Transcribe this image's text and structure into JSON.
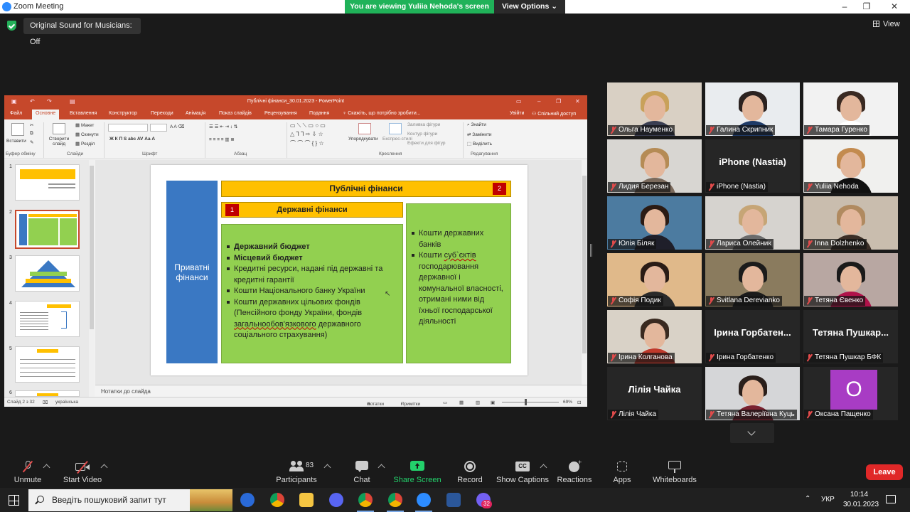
{
  "window": {
    "title": "Zoom Meeting",
    "viewing_banner": "You are viewing Yuliia Nehoda's screen",
    "view_options": "View Options",
    "minimize": "–",
    "maximize": "❐",
    "close": "✕"
  },
  "top": {
    "sound_badge": "Original Sound for Musicians: Off",
    "view_label": "View"
  },
  "ppt": {
    "doc_title": "Публічні фінанси_30.01.2023 - PowerPoint",
    "tabs": [
      "Файл",
      "Основне",
      "Вставлення",
      "Конструктор",
      "Переходи",
      "Анімація",
      "Показ слайдів",
      "Рецензування",
      "Подання"
    ],
    "tell_me": "Скажіть, що потрібно зробити...",
    "sign_in": "Увійти",
    "share": "Спільний доступ",
    "ribbon": {
      "paste": "Вставити",
      "clipboard_group": "Буфер обміну",
      "layout": "Макет",
      "reset": "Скинути",
      "section": "Розділ",
      "new_slide": "Створити слайд",
      "slides_group": "Слайди",
      "font_group": "Шрифт",
      "paragraph_group": "Абзац",
      "arrange": "Упорядкувати",
      "quick_styles": "Експрес-стилі",
      "shape_fill": "Заливка фігури",
      "shape_outline": "Контур фігури",
      "shape_effects": "Ефекти для фігур",
      "drawing_group": "Креслення",
      "find": "Знайти",
      "replace": "Замінити",
      "select": "Виділить",
      "editing_group": "Редагування"
    },
    "thumb_numbers": [
      "1",
      "2",
      "3",
      "4",
      "5",
      "6"
    ],
    "slide": {
      "private": "Приватні фінанси",
      "public": "Публічні фінанси",
      "state": "Державні фінанси",
      "badge_public": "2",
      "badge_state": "1",
      "state_items_bold": [
        "Державний бюджет",
        "Місцевий бюджет"
      ],
      "state_item_3": "Кредитні ресурси, надані під державні та кредитні гарантії",
      "state_item_4": "Кошти Національного банку України",
      "state_item_5_a": "Кошти державних цільових фондів (Пенсійного фонду України, фондів ",
      "state_item_5_u": "загальнообов'язкового",
      "state_item_5_b": " державного соціального страхування)",
      "other_item_1": "Кошти державних банків",
      "other_item_2_a": "Кошти ",
      "other_item_2_u": "суб`єктів",
      "other_item_2_b": " господарювання державної і комунальної власності, отримані ними від їхньої господарської діяльності"
    },
    "notes": "Нотатки до слайда",
    "status": {
      "slide_of": "Слайд 2 з 32",
      "language": "українська",
      "notes_btn": "Нотатки",
      "comments_btn": "Примітки",
      "zoom": "69%"
    }
  },
  "participants": [
    {
      "name": "Ольга Науменко",
      "video": true,
      "bg": "#d9d0c4",
      "hair": "#c9a15a",
      "body": "#3a3e52"
    },
    {
      "name": "Галина Скрипник",
      "video": true,
      "bg": "#e9ecef",
      "hair": "#2b2220",
      "body": "#1f3b68"
    },
    {
      "name": "Тамара Гуренко",
      "video": true,
      "bg": "#f2f2f2",
      "hair": "#3a2a22",
      "body": "#ffffff"
    },
    {
      "name": "Лидия Березан",
      "video": true,
      "bg": "#d8d6d2",
      "hair": "#b58b55",
      "body": "#7b6a5c"
    },
    {
      "name": "iPhone (Nastia)",
      "video": false,
      "display": "iPhone (Nastia)"
    },
    {
      "name": "Yuliia Nehoda",
      "video": true,
      "bg": "#f0f0ee",
      "hair": "#c38b4f",
      "body": "#111111",
      "active": true
    },
    {
      "name": "Юлія Біляк",
      "video": true,
      "bg": "#4c7ba0",
      "hair": "#2b1b14",
      "body": "#1f1f2a"
    },
    {
      "name": "Лариса Олейник",
      "video": true,
      "bg": "#d6d3cf",
      "hair": "#c6a576",
      "body": "#6b6b6b"
    },
    {
      "name": "Inna Dolzhenko",
      "video": true,
      "bg": "#c9bdae",
      "hair": "#b08a60",
      "body": "#3c2f27"
    },
    {
      "name": "Софія Подик",
      "video": true,
      "bg": "#e0b98a",
      "hair": "#2a1c16",
      "body": "#2a2a2a"
    },
    {
      "name": "Svitlana Derevianko",
      "video": true,
      "bg": "#8a7b5e",
      "hair": "#1b1b1b",
      "body": "#1b1b1b"
    },
    {
      "name": "Тетяна Євенко",
      "video": true,
      "bg": "#b8a7a2",
      "hair": "#1a1a1a",
      "body": "#b0124a"
    },
    {
      "name": "Ірина Колганова",
      "video": true,
      "bg": "#d9d2c7",
      "hair": "#3a2a20",
      "body": "#c0392b"
    },
    {
      "name": "Ірина Горбатенко",
      "video": false,
      "display": "Ірина Горбатен..."
    },
    {
      "name": "Тетяна Пушкар БФК",
      "video": false,
      "display": "Тетяна Пушкар..."
    },
    {
      "name": "Лілія Чайка",
      "video": false,
      "display": "Лілія Чайка"
    },
    {
      "name": "Тетяна Валеріївна Куць",
      "video": true,
      "bg": "#d5d6d8",
      "hair": "#2a1f1b",
      "body": "#7a2230"
    },
    {
      "name": "Оксана Пащенко",
      "video": false,
      "avatar": "O"
    }
  ],
  "toolbar": {
    "unmute": "Unmute",
    "start_video": "Start Video",
    "participants": "Participants",
    "participants_count": "83",
    "chat": "Chat",
    "share_screen": "Share Screen",
    "record": "Record",
    "show_captions": "Show Captions",
    "reactions": "Reactions",
    "apps": "Apps",
    "whiteboards": "Whiteboards",
    "leave": "Leave"
  },
  "taskbar": {
    "search_placeholder": "Введіть пошуковий запит тут",
    "lang": "УКР",
    "time": "10:14",
    "date": "30.01.2023",
    "badge_count": "32"
  },
  "colors": {
    "zoom_blue": "#2d8cff",
    "banner_green": "#20b259",
    "ppt_red": "#c6482b",
    "slide_blue": "#3a78c3",
    "slide_yellow": "#ffc000",
    "slide_green": "#92d050",
    "leave_red": "#e02828"
  }
}
